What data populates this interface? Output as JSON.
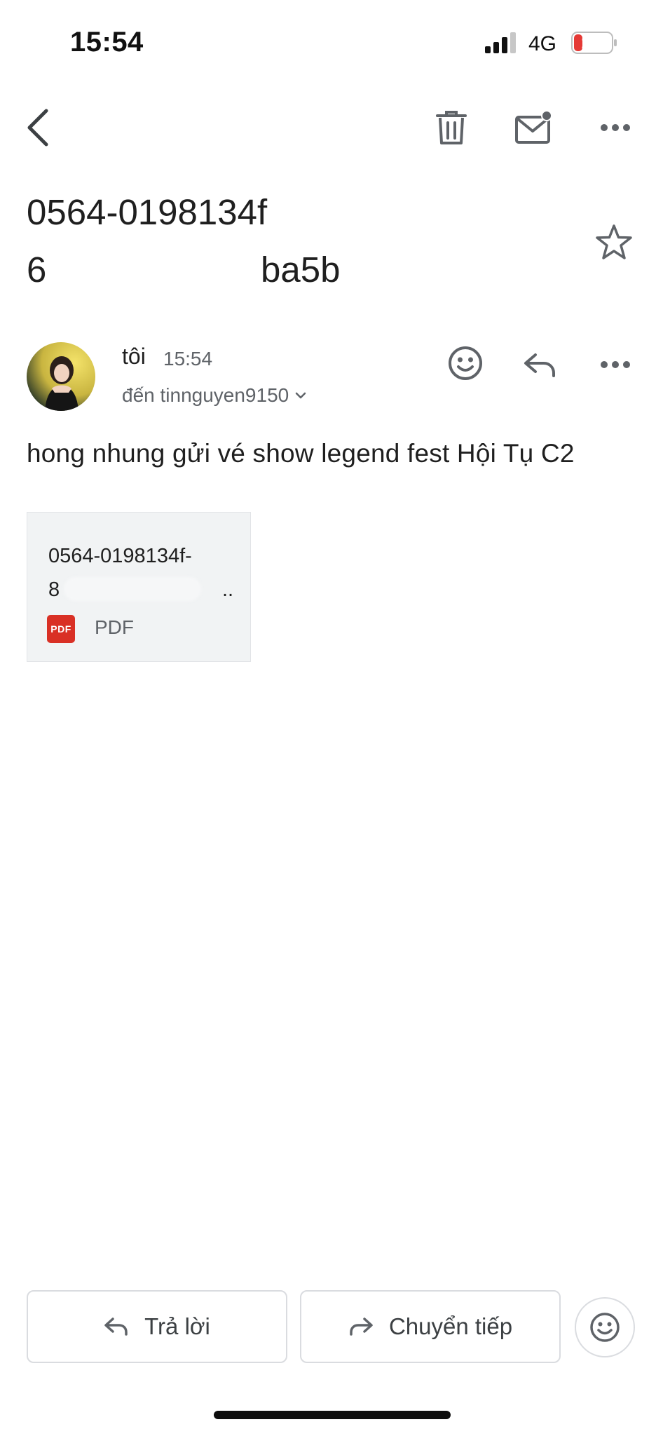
{
  "status_bar": {
    "time": "15:54",
    "network": "4G",
    "battery": "11"
  },
  "toolbar": {
    "back_icon": "chevron-left-icon",
    "delete_icon": "trash-icon",
    "mark_unread_icon": "mail-unread-icon",
    "more_icon": "more-horizontal-icon"
  },
  "email": {
    "subject_line1": "0564-0198134f",
    "subject_line2_start": "6",
    "subject_line2_end": "ba5b",
    "sender": {
      "name": "tôi",
      "time": "15:54"
    },
    "recipients": "đến tinnguyen9150",
    "body": "hong nhung gửi vé show legend fest Hội Tụ C2",
    "attachment": {
      "name_line1": "0564-0198134f-",
      "name_line2_start": "8",
      "name_line2_end": "..",
      "badge": "PDF",
      "type": "PDF"
    }
  },
  "actions": {
    "reply": "Trả lời",
    "forward": "Chuyển tiếp"
  },
  "colors": {
    "pdf_red": "#d93025",
    "icon_gray": "#5f6368",
    "border": "#dadce0"
  }
}
